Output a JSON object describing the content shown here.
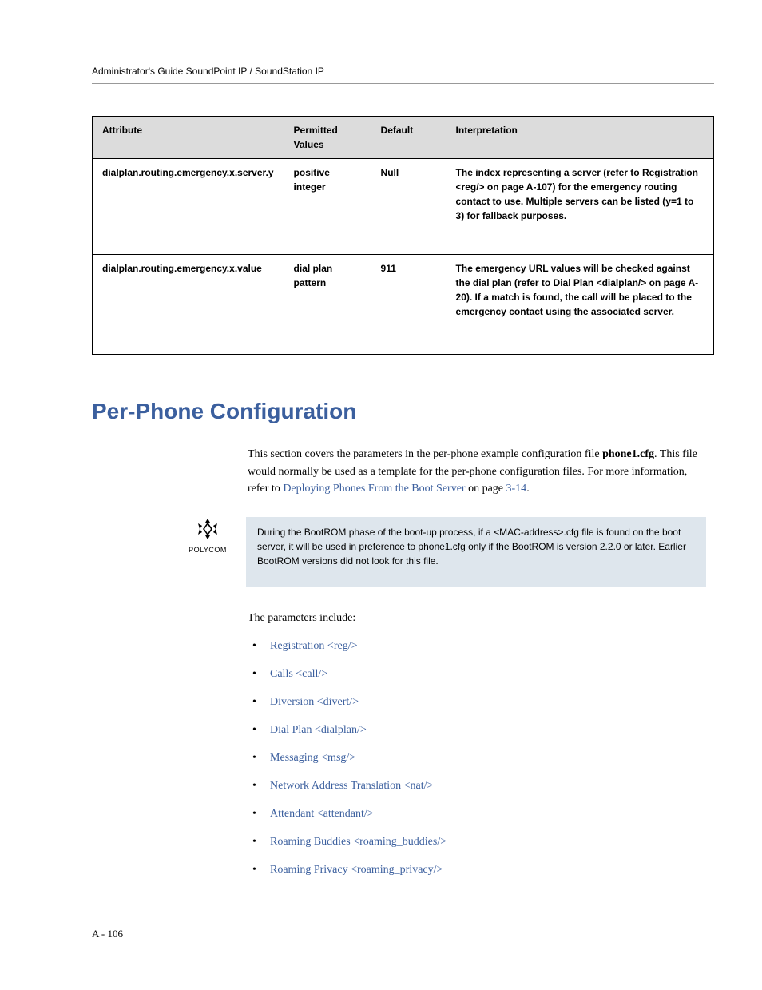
{
  "header": {
    "title": "Administrator's Guide SoundPoint IP / SoundStation IP"
  },
  "table": {
    "headers": {
      "c1": "Attribute",
      "c2": "Permitted Values",
      "c3": "Default",
      "c4": "Interpretation"
    },
    "rows": [
      {
        "c1": "dialplan.routing.emergency.x.server.y",
        "c2": "positive integer",
        "c3": "Null",
        "c4": "The index representing a server (refer to Registration <reg/> on page A-107) for the emergency routing contact to use. Multiple servers can be listed (y=1 to 3) for fallback purposes."
      },
      {
        "c1": "dialplan.routing.emergency.x.value",
        "c2": "dial plan pattern",
        "c3": "911",
        "c4": "The emergency URL values will be checked against the dial plan (refer to Dial Plan <dialplan/> on page A-20). If a match is found, the call will be placed to the emergency contact using the associated server."
      }
    ]
  },
  "heading": "Per-Phone Configuration",
  "intro": {
    "part1": "This section covers the parameters in the per-phone example configuration file ",
    "bold": "phone1.cfg",
    "part2": ". This file would normally be used as a template for the per-phone configuration files. For more information, refer to ",
    "link": "Deploying Phones From the Boot Server",
    "part3": " on page ",
    "pageref": "3-14",
    "part4": "."
  },
  "note": {
    "logoWord": "POLYCOM",
    "body": "During the BootROM phase of the boot-up process, if a <MAC-address>.cfg file is found on the boot server, it will be used in preference to phone1.cfg only if the BootROM is version 2.2.0 or later. Earlier BootROM versions did not look for this file."
  },
  "listIntro": "The parameters include:",
  "links": [
    "Registration <reg/>",
    "Calls <call/>",
    "Diversion <divert/>",
    "Dial Plan <dialplan/>",
    "Messaging <msg/>",
    "Network Address Translation <nat/>",
    "Attendant <attendant/>",
    "Roaming Buddies <roaming_buddies/>",
    "Roaming Privacy <roaming_privacy/>"
  ],
  "footer": "A - 106"
}
